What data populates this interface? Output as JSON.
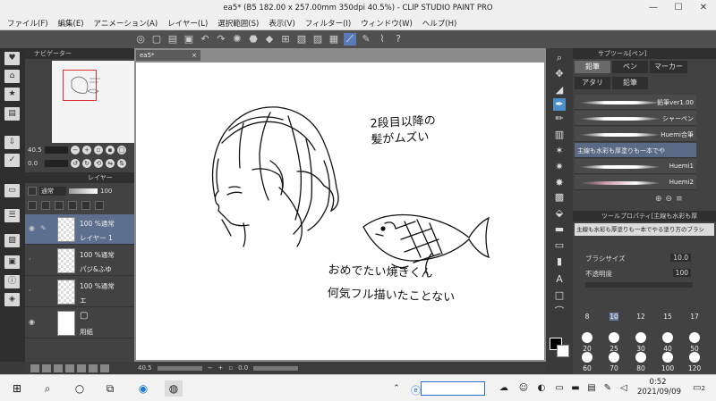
{
  "window": {
    "title": "ea5* (B5 182.00 x 257.00mm 350dpi 40.5%) - CLIP STUDIO PAINT PRO",
    "min_label": "—",
    "max_label": "☐",
    "close_label": "✕"
  },
  "menu": [
    "ファイル(F)",
    "編集(E)",
    "アニメーション(A)",
    "レイヤー(L)",
    "選択範囲(S)",
    "表示(V)",
    "フィルター(I)",
    "ウィンドウ(W)",
    "ヘルプ(H)"
  ],
  "navigator": {
    "tab_label": "ナビゲーター",
    "zoom_value": "40.5",
    "rotate_value": "0.0"
  },
  "layers": {
    "tab_label": "レイヤー",
    "blend_mode": "通常",
    "opacity_value": "100",
    "rows": [
      {
        "mode": "100 %通常",
        "name": "レイヤー 1",
        "selected": true
      },
      {
        "mode": "100 %通常",
        "name": "パジ&ふゆ",
        "selected": false
      },
      {
        "mode": "100 %通常",
        "name": "エ",
        "selected": false
      },
      {
        "mode": "",
        "name": "用紙",
        "selected": false
      }
    ]
  },
  "canvas": {
    "tab_label": "ea5*",
    "tab_close": "×",
    "status_zoom": "40.5",
    "status_angle": "0.0",
    "note1_line1": "2段目以降の",
    "note1_line2": "髪がムズい",
    "note2_line1": "おめでたい焼きくん",
    "note2_line2": "何気フル描いたことない"
  },
  "subtool": {
    "header": "サブツール[ペン]",
    "tabs": [
      "鉛筆",
      "ペン",
      "マーカー",
      "アタリ",
      "鉛筆"
    ],
    "brushes": [
      {
        "name": "鉛筆ver1.00",
        "selected": false
      },
      {
        "name": "シャーペン",
        "selected": false
      },
      {
        "name": "Huemi合筆",
        "selected": false
      },
      {
        "name": "主線も水彩も厚塗りも一本でや",
        "selected": true
      },
      {
        "name": "Huemi1",
        "selected": false
      },
      {
        "name": "Huemi2",
        "selected": false
      }
    ]
  },
  "tool_property": {
    "header": "ツールプロパティ[主線も水彩も厚",
    "preview_name": "主線も水彩も厚塗りも一本でやる塗り方のブラシ",
    "brush_size_label": "ブラシサイズ",
    "brush_size_value": "10.0",
    "opacity_label": "不透明度",
    "opacity_value": "100"
  },
  "brush_sizes": [
    "8",
    "10",
    "12",
    "15",
    "17",
    "20",
    "25",
    "30",
    "40",
    "50",
    "60",
    "70",
    "80",
    "100",
    "120"
  ],
  "selected_brush_size": "10",
  "taskbar": {
    "time": "0:52",
    "date": "2021/09/09",
    "notification_count": "2"
  }
}
